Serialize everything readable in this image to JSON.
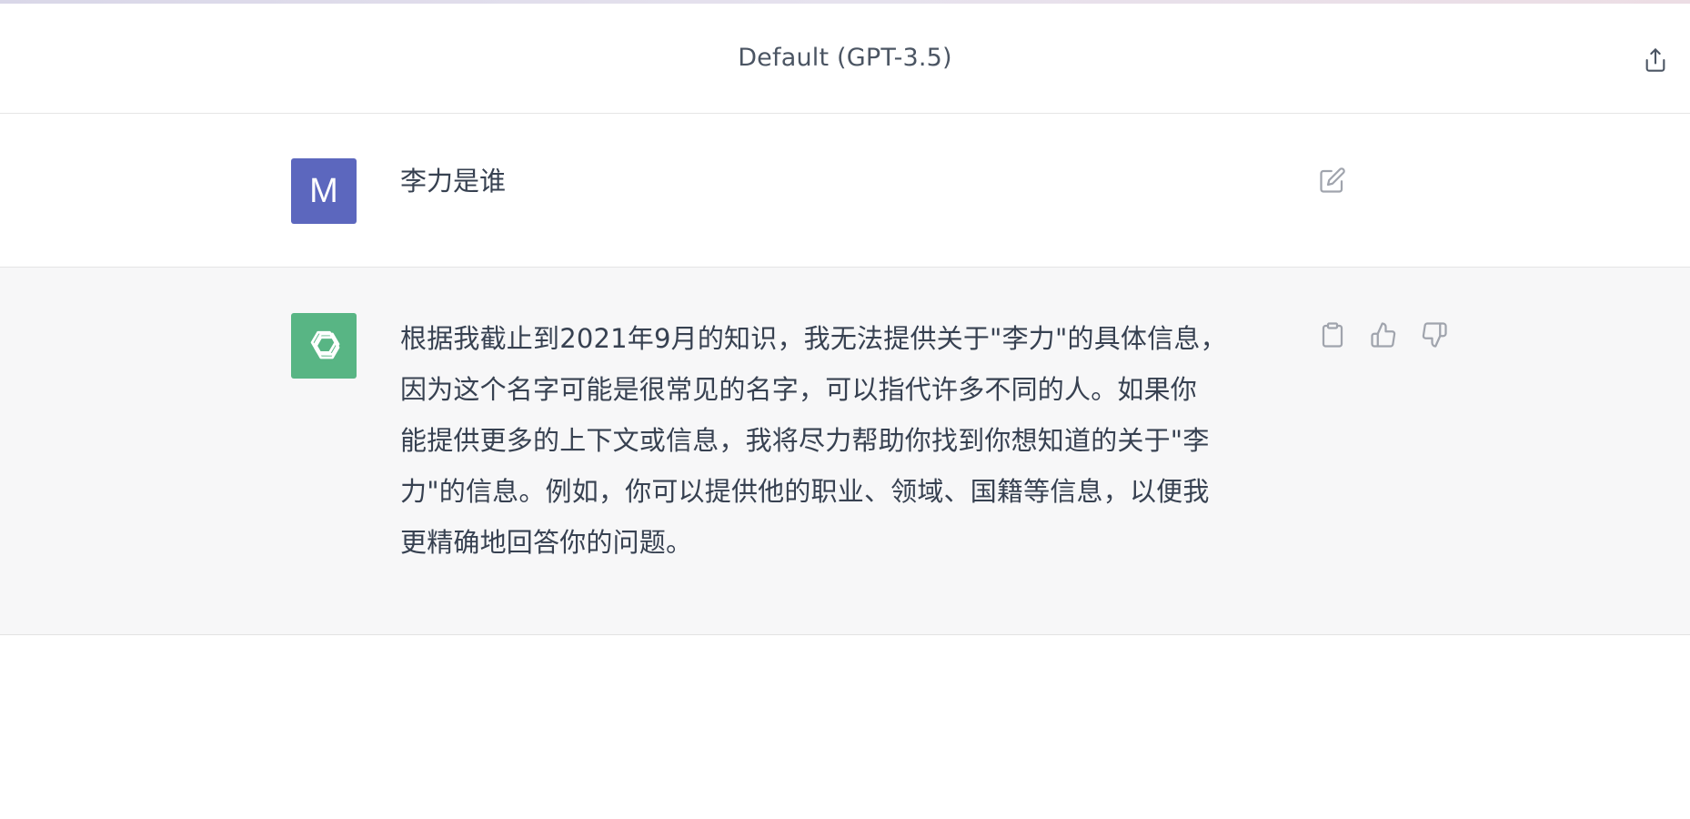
{
  "header": {
    "model_title": "Default (GPT-3.5)",
    "share_icon": "share-icon"
  },
  "conversation": {
    "user_message": {
      "avatar_initial": "M",
      "avatar_color": "#5c67be",
      "text": "李力是谁",
      "edit_icon": "edit-icon"
    },
    "assistant_message": {
      "avatar_icon": "openai-logo-icon",
      "avatar_color": "#58b584",
      "lines": [
        "根据我截止到2021年9月的知识，我无法提供关于\"李力\"的具体信息，",
        "因为这个名字可能是很常见的名字，可以指代许多不同的人。如果你",
        "能提供更多的上下文或信息，我将尽力帮助你找到你想知道的关于\"李",
        "力\"的信息。例如，你可以提供他的职业、领域、国籍等信息，以便我",
        "更精确地回答你的问题。"
      ],
      "actions": [
        "copy-icon",
        "thumbs-up-icon",
        "thumbs-down-icon"
      ]
    }
  }
}
